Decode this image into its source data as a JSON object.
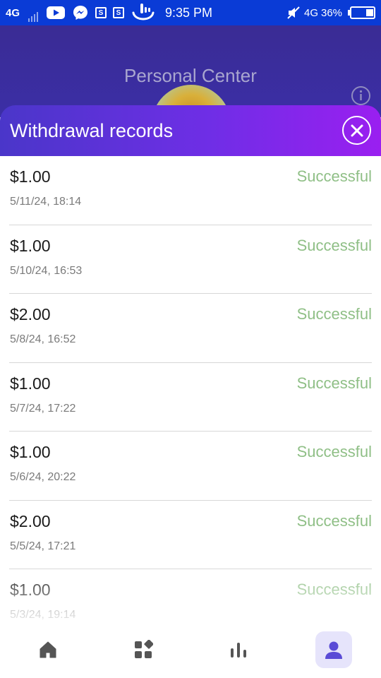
{
  "status_bar": {
    "network": "4G",
    "time": "9:35 PM",
    "network_right": "4G",
    "battery": "36%",
    "icons": [
      "signal-icon",
      "youtube-icon",
      "messenger-icon",
      "s-app-icon",
      "s-app-icon",
      "touchpal-icon",
      "mute-icon",
      "battery-icon"
    ],
    "s_letter": "S"
  },
  "page": {
    "title": "Personal Center",
    "info_icon": "info-icon"
  },
  "sheet": {
    "title": "Withdrawal records",
    "close_icon": "close-icon"
  },
  "records": [
    {
      "amount": "$1.00",
      "time": "5/11/24, 18:14",
      "status": "Successful"
    },
    {
      "amount": "$1.00",
      "time": "5/10/24, 16:53",
      "status": "Successful"
    },
    {
      "amount": "$2.00",
      "time": "5/8/24, 16:52",
      "status": "Successful"
    },
    {
      "amount": "$1.00",
      "time": "5/7/24, 17:22",
      "status": "Successful"
    },
    {
      "amount": "$1.00",
      "time": "5/6/24, 20:22",
      "status": "Successful"
    },
    {
      "amount": "$2.00",
      "time": "5/5/24, 17:21",
      "status": "Successful"
    },
    {
      "amount": "$1.00",
      "time": "5/3/24, 19:14",
      "status": "Successful"
    }
  ],
  "bottom_nav": {
    "items": [
      "home-icon",
      "apps-icon",
      "chart-icon",
      "profile-icon"
    ],
    "active": "profile-icon"
  },
  "colors": {
    "status_bar": "#0a3bd6",
    "header_bg": "#3a2c94",
    "sheet_gradient_start": "#4a36c9",
    "sheet_gradient_end": "#9a1ff0",
    "status_success": "#8fbf86",
    "nav_icon": "#555555",
    "nav_active": "#5a4bd6"
  }
}
